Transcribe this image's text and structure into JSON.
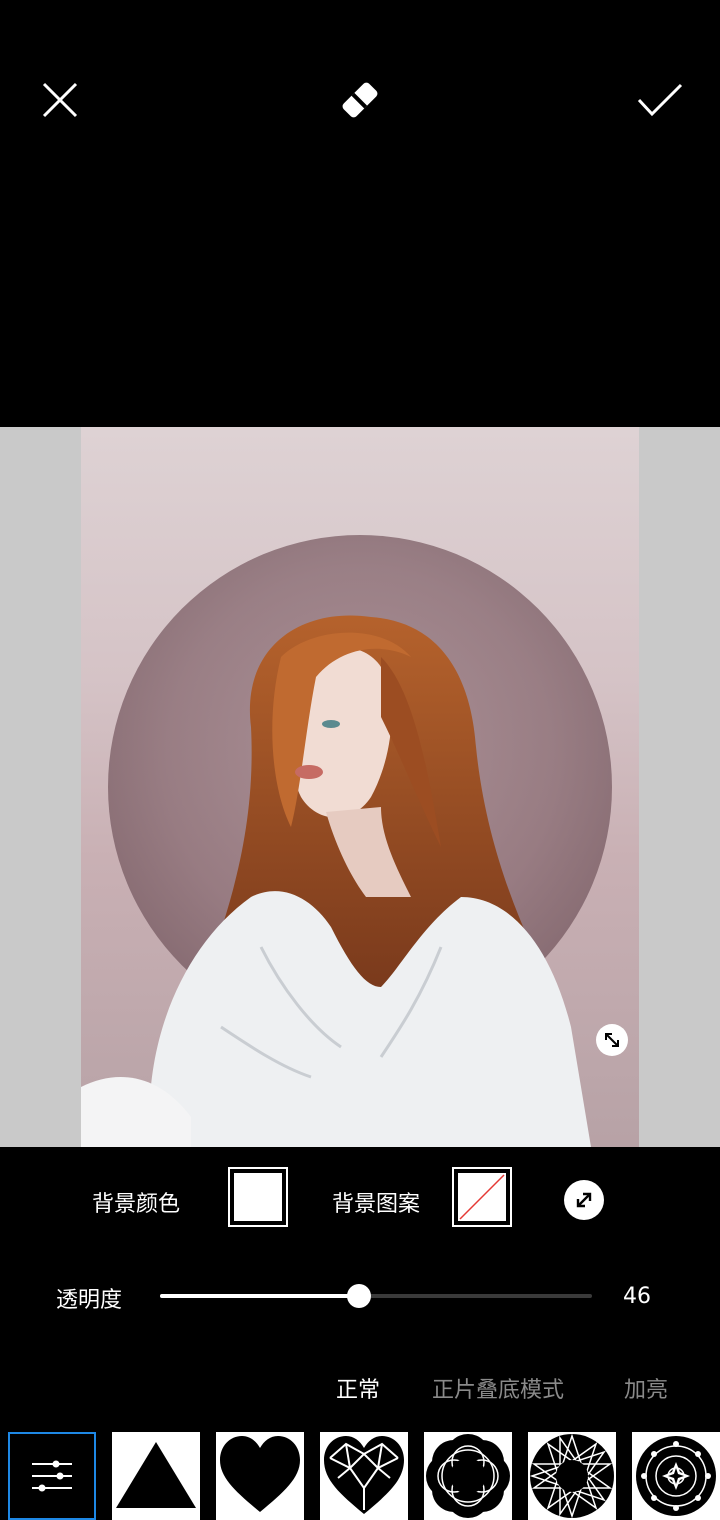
{
  "toolbar": {
    "close_icon": "close-icon",
    "eraser_icon": "eraser-icon",
    "confirm_icon": "check-icon"
  },
  "background": {
    "color_label": "背景颜色",
    "color_value": "#ffffff",
    "pattern_label": "背景图案",
    "pattern_value": "none",
    "swap_icon": "swap-arrows-icon"
  },
  "opacity": {
    "label": "透明度",
    "value": "46",
    "fraction": 0.46
  },
  "blend_modes": [
    {
      "label": "正常",
      "selected": true
    },
    {
      "label": "正片叠底模式",
      "selected": false
    },
    {
      "label": "加亮",
      "selected": false
    }
  ],
  "shapes": [
    "adjust-sliders-icon",
    "triangle-icon",
    "heart-icon",
    "faceted-heart-icon",
    "flower-ring-icon",
    "star-ring-icon",
    "mandala-icon"
  ],
  "colors": {
    "accent": "#1e88e5",
    "canvas_bg": "#c9c9c9",
    "inactive_text": "#8a8a8a"
  }
}
